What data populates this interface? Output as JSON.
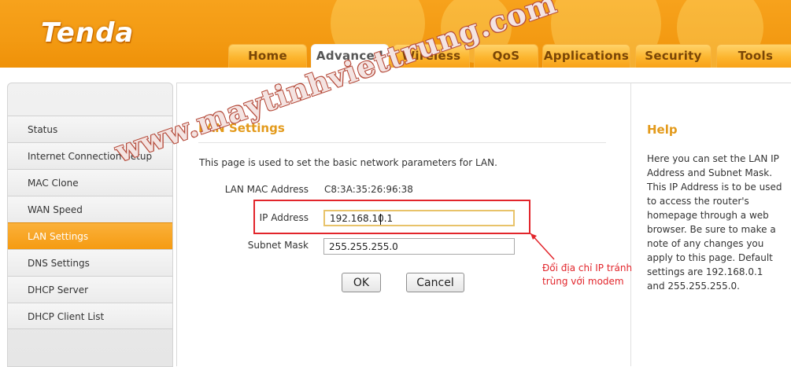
{
  "brand": {
    "logo_text": "Tenda",
    "accent": "#f39a12",
    "highlight": "#e2252b"
  },
  "nav": {
    "tabs": [
      {
        "label": "Home",
        "active": false
      },
      {
        "label": "Advanced",
        "active": true
      },
      {
        "label": "Wireless",
        "active": false
      },
      {
        "label": "QoS",
        "active": false
      },
      {
        "label": "Applications",
        "active": false
      },
      {
        "label": "Security",
        "active": false
      },
      {
        "label": "Tools",
        "active": false
      }
    ]
  },
  "sidebar": {
    "items": [
      {
        "label": "Status",
        "active": false
      },
      {
        "label": "Internet Connection Setup",
        "active": false
      },
      {
        "label": "MAC Clone",
        "active": false
      },
      {
        "label": "WAN Speed",
        "active": false
      },
      {
        "label": "LAN Settings",
        "active": true
      },
      {
        "label": "DNS Settings",
        "active": false
      },
      {
        "label": "DHCP Server",
        "active": false
      },
      {
        "label": "DHCP Client List",
        "active": false
      }
    ]
  },
  "main": {
    "title": "LAN Settings",
    "description": "This page is used to set the basic network parameters for LAN.",
    "mac_label": "LAN MAC Address",
    "mac_value": "C8:3A:35:26:96:38",
    "ip_label": "IP Address",
    "ip_value": "192.168.10.1",
    "mask_label": "Subnet Mask",
    "mask_value": "255.255.255.0",
    "ok_label": "OK",
    "cancel_label": "Cancel"
  },
  "help": {
    "title": "Help",
    "text": "Here you can set the LAN IP Address and Subnet Mask. This IP Address is to be used to access the router's homepage through a web browser. Be sure to make a note of any changes you apply to this page. Default settings are 192.168.0.1 and 255.255.255.0."
  },
  "annotation": {
    "note": "Đổi địa chỉ IP tránh trùng với modem",
    "watermark": "www.maytinhviettrung.com"
  }
}
